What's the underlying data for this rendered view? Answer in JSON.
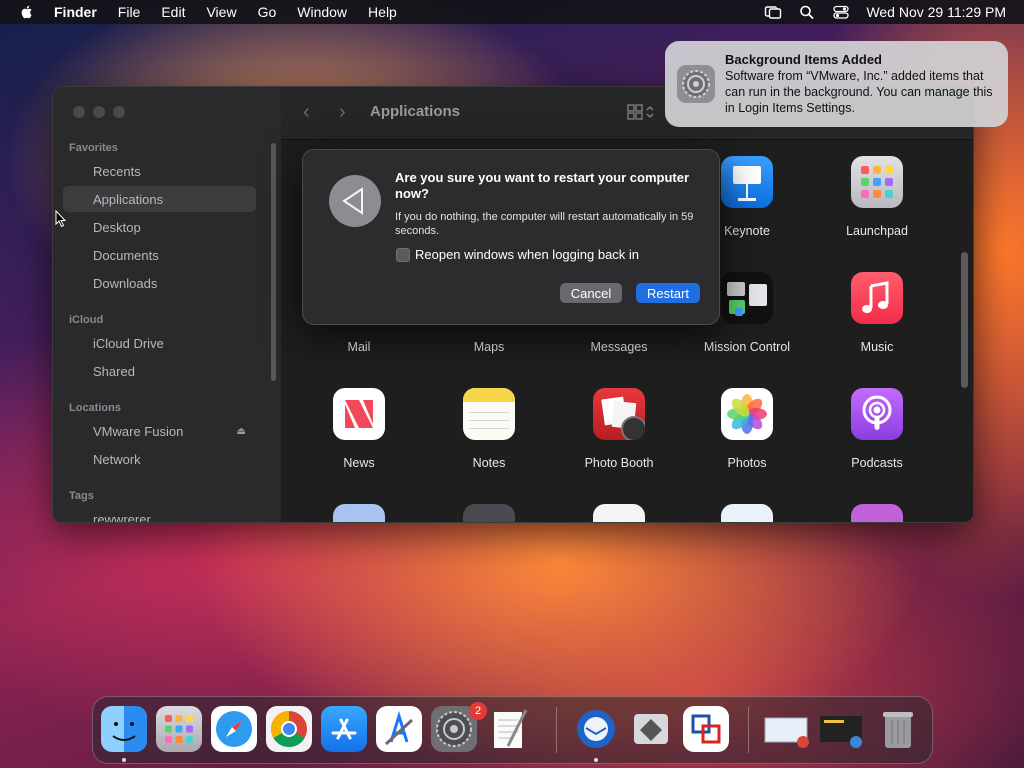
{
  "menubar": {
    "app_name": "Finder",
    "items": [
      "File",
      "Edit",
      "View",
      "Go",
      "Window",
      "Help"
    ],
    "clock": "Wed Nov 29  11:29 PM",
    "icons": [
      "apple-icon",
      "screen-mirroring-icon",
      "search-icon",
      "control-center-icon"
    ]
  },
  "finder": {
    "title": "Applications",
    "sidebar": {
      "favorites_header": "Favorites",
      "favorites": [
        "Recents",
        "Applications",
        "Desktop",
        "Documents",
        "Downloads"
      ],
      "icloud_header": "iCloud",
      "icloud": [
        "iCloud Drive",
        "Shared"
      ],
      "locations_header": "Locations",
      "locations": [
        "VMware Fusion",
        "Network"
      ],
      "tags_header": "Tags",
      "tags": [
        "rewwrerer"
      ]
    },
    "apps": [
      {
        "name": "Keynote",
        "color": "#1a8cff"
      },
      {
        "name": "Launchpad",
        "color": "#c9c9cf"
      },
      {
        "name": "Mail",
        "color": ""
      },
      {
        "name": "Maps",
        "color": ""
      },
      {
        "name": "Messages",
        "color": ""
      },
      {
        "name": "Mission Control",
        "color": "#1c1c1e"
      },
      {
        "name": "Music",
        "color": "#fb3c54"
      },
      {
        "name": "News",
        "color": "#ffffff"
      },
      {
        "name": "Notes",
        "color": "#f7d54b"
      },
      {
        "name": "Photo Booth",
        "color": "#d6262b"
      },
      {
        "name": "Photos",
        "color": "#ffffff"
      },
      {
        "name": "Podcasts",
        "color": "#a64fe8"
      }
    ]
  },
  "dialog": {
    "title": "Are you sure you want to restart your computer now?",
    "message": "If you do nothing, the computer will restart automatically in 59 seconds.",
    "checkbox_label": "Reopen windows when logging back in",
    "checkbox_checked": false,
    "cancel_label": "Cancel",
    "restart_label": "Restart"
  },
  "notification": {
    "title": "Background Items Added",
    "body": "Software from “VMware, Inc.” added items that can run in the background. You can manage this in Login Items Settings."
  },
  "dock": {
    "apps": [
      "Finder",
      "Launchpad",
      "Safari",
      "Google Chrome",
      "App Store",
      "Xcode",
      "System Settings",
      "TextEdit",
      "Thunderbird",
      "Boot Camp Assistant",
      "VMware Fusion",
      "Recent Item 1",
      "Recent Item 2",
      "Trash"
    ],
    "system_settings_badge": "2"
  }
}
